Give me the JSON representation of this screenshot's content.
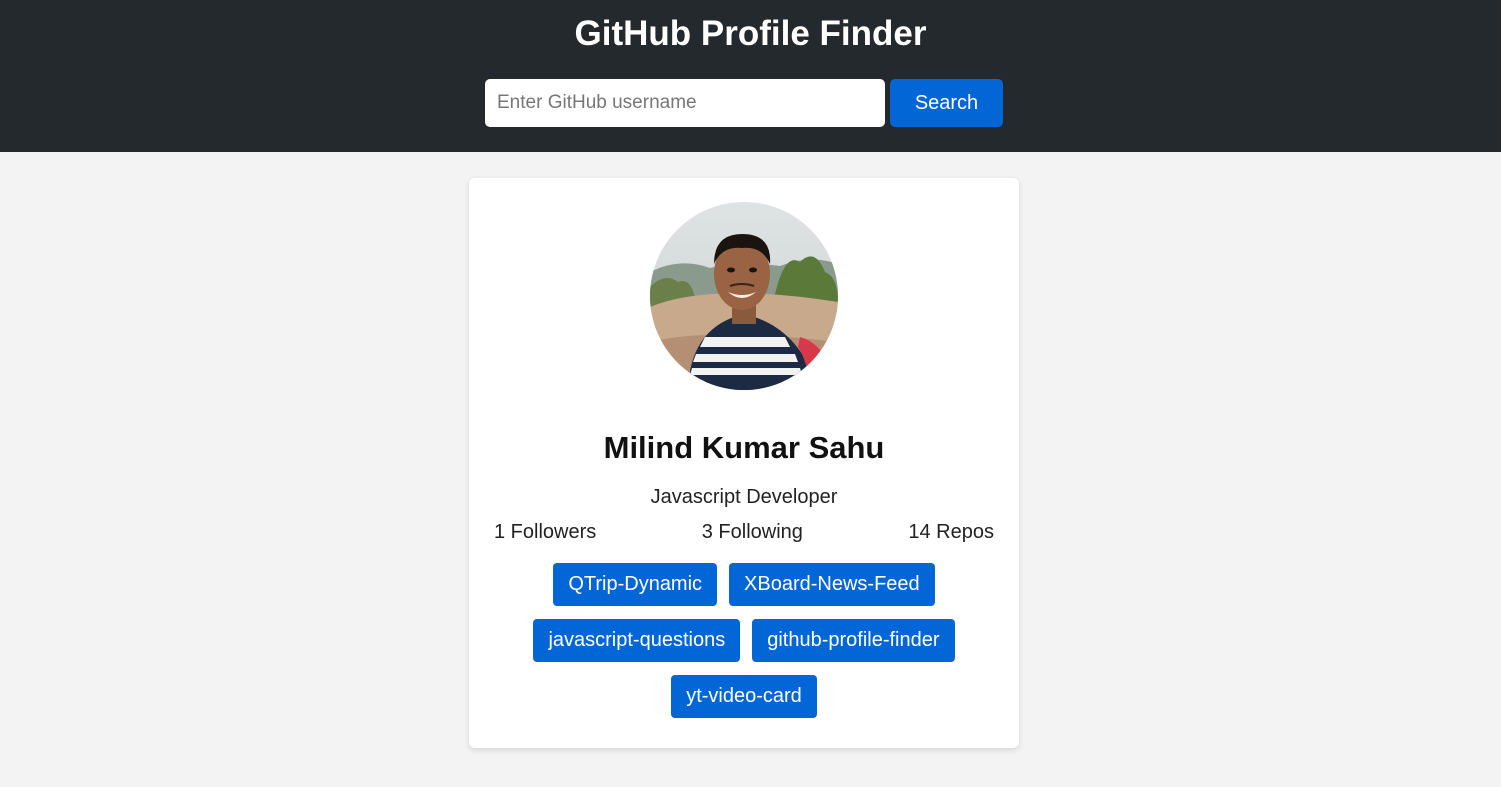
{
  "header": {
    "title": "GitHub Profile Finder",
    "background": "#24292e"
  },
  "search": {
    "placeholder": "Enter GitHub username",
    "value": "",
    "button_label": "Search",
    "button_color": "#0366d6"
  },
  "profile": {
    "avatar_icon": "user-photo-avatar",
    "name": "Milind Kumar Sahu",
    "bio": "Javascript Developer",
    "stats": {
      "followers": "1 Followers",
      "following": "3 Following",
      "repos": "14 Repos"
    },
    "repositories": [
      "QTrip-Dynamic",
      "XBoard-News-Feed",
      "javascript-questions",
      "github-profile-finder",
      "yt-video-card"
    ]
  }
}
